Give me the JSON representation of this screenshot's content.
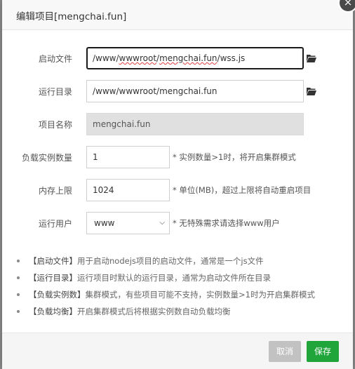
{
  "dialog": {
    "title": "编辑项目[mengchai.fun]",
    "close_symbol": "×"
  },
  "form": {
    "start_file": {
      "label": "启动文件",
      "value_prefix": "/www/",
      "value_wwwroot": "wwwroot",
      "value_sep1": "/",
      "value_domain": "mengchai.fun",
      "value_suffix": "/wss.js",
      "icon": "folder-icon"
    },
    "run_dir": {
      "label": "运行目录",
      "value": "/www/wwwroot/mengchai.fun",
      "icon": "folder-icon"
    },
    "project_name": {
      "label": "项目名称",
      "value": "mengchai.fun"
    },
    "instances": {
      "label": "负载实例数量",
      "value": "1",
      "hint": "* 实例数量>1时，将开启集群模式"
    },
    "memory": {
      "label": "内存上限",
      "value": "1024",
      "hint": "* 单位(MB)，超过上限将自动重启项目"
    },
    "run_user": {
      "label": "运行用户",
      "value": "www",
      "hint": "* 无特殊需求请选择www用户"
    }
  },
  "tips": [
    {
      "key": "【启动文件】",
      "text": "用于启动nodejs项目的启动文件，通常是一个js文件"
    },
    {
      "key": "【运行目录】",
      "text": "运行项目时默认的运行目录，通常为启动文件所在目录"
    },
    {
      "key": "【负载实例数】",
      "text": "集群模式，有些项目可能不支持，实例数量>1时为开启集群模式"
    },
    {
      "key": "【负载均衡】",
      "text": "开启集群模式后将根据实例数自动负载均衡"
    }
  ],
  "footer": {
    "cancel_label": "取消",
    "save_label": "保存"
  },
  "colors": {
    "save": "#20a53a",
    "cancel": "#c2c2c2",
    "overlay": "#8a8a8a"
  }
}
